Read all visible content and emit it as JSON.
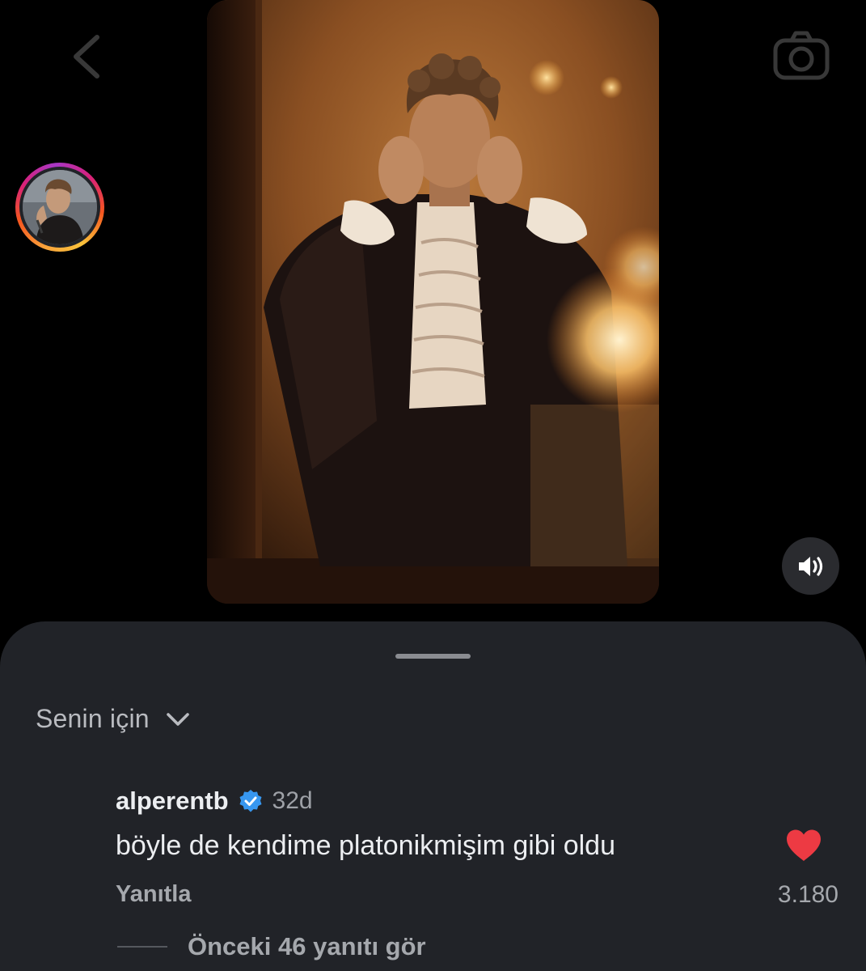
{
  "top_bar": {
    "back_icon": "chevron-left-icon",
    "camera_icon": "camera-icon"
  },
  "media": {
    "type": "video",
    "sound_icon": "speaker-icon"
  },
  "comments_sheet": {
    "filter_label": "Senin için",
    "filter_icon": "chevron-down-icon",
    "comment": {
      "username": "alperentb",
      "verified": true,
      "timestamp": "32d",
      "text": "böyle de kendime platonikmişim gibi oldu",
      "reply_label": "Yanıtla",
      "like_count": "3.180",
      "liked": true,
      "like_color": "#ed3a43",
      "view_replies_label": "Önceki 46 yanıtı gör"
    }
  },
  "colors": {
    "background": "#000000",
    "sheet": "#212328",
    "verified_blue": "#3797f0"
  }
}
